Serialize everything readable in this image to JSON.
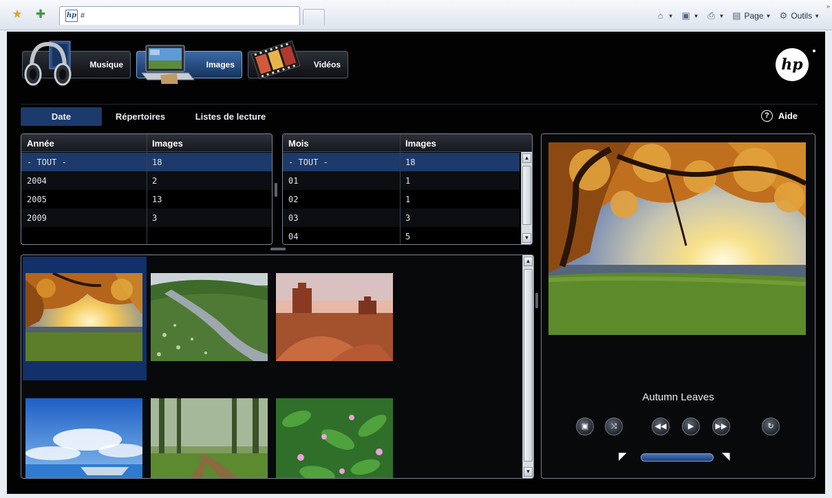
{
  "browser": {
    "tab_title": "#",
    "tab_favicon": "hp",
    "commands": {
      "page": "Page",
      "tools": "Outils"
    }
  },
  "media_tabs": {
    "music": "Musique",
    "images": "Images",
    "videos": "Vidéos"
  },
  "brand": "hp",
  "subnav": {
    "date": "Date",
    "folders": "Répertoires",
    "playlists": "Listes de lecture",
    "help": "Aide",
    "help_icon": "?"
  },
  "years_table": {
    "headers": [
      "Année",
      "Images"
    ],
    "rows": [
      [
        "- TOUT -",
        "18"
      ],
      [
        "2004",
        "2"
      ],
      [
        "2005",
        "13"
      ],
      [
        "2009",
        "3"
      ]
    ]
  },
  "months_table": {
    "headers": [
      "Mois",
      "Images"
    ],
    "rows": [
      [
        "- TOUT -",
        "18"
      ],
      [
        "01",
        "1"
      ],
      [
        "02",
        "1"
      ],
      [
        "03",
        "3"
      ],
      [
        "04",
        "5"
      ]
    ]
  },
  "thumbnails": [
    {
      "name": "autumn-leaves",
      "selected": true
    },
    {
      "name": "river-meadow",
      "selected": false
    },
    {
      "name": "desert-butte",
      "selected": false
    },
    {
      "name": "blue-sky-lake",
      "selected": false
    },
    {
      "name": "forest-path",
      "selected": false
    },
    {
      "name": "green-flowers",
      "selected": false
    }
  ],
  "preview": {
    "title": "Autumn Leaves"
  },
  "colors": {
    "background": "#020203",
    "accent": "#1c3a6b",
    "highlight": "#12306a"
  }
}
